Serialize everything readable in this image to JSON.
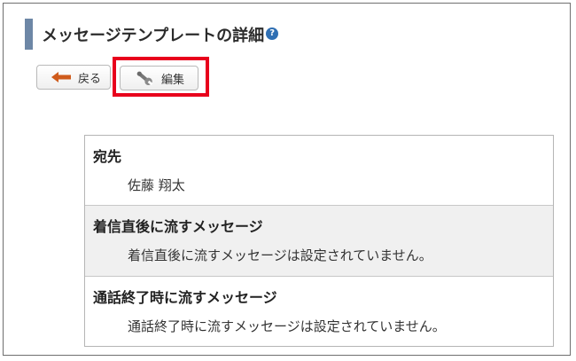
{
  "page": {
    "title": "メッセージテンプレートの詳細",
    "help_icon": "help-icon"
  },
  "toolbar": {
    "back_label": "戻る",
    "edit_label": "編集",
    "back_icon": "arrow-left-icon",
    "edit_icon": "wrench-icon",
    "highlight_color": "#e8001c"
  },
  "details": [
    {
      "label": "宛先",
      "value": "佐藤 翔太"
    },
    {
      "label": "着信直後に流すメッセージ",
      "value": "着信直後に流すメッセージは設定されていません。"
    },
    {
      "label": "通話終了時に流すメッセージ",
      "value": "通話終了時に流すメッセージは設定されていません。"
    }
  ],
  "colors": {
    "accent": "#6d87a6",
    "section_shade": "#f0f0f0",
    "arrow": "#cf5b1c",
    "help": "#2f6fb3"
  }
}
